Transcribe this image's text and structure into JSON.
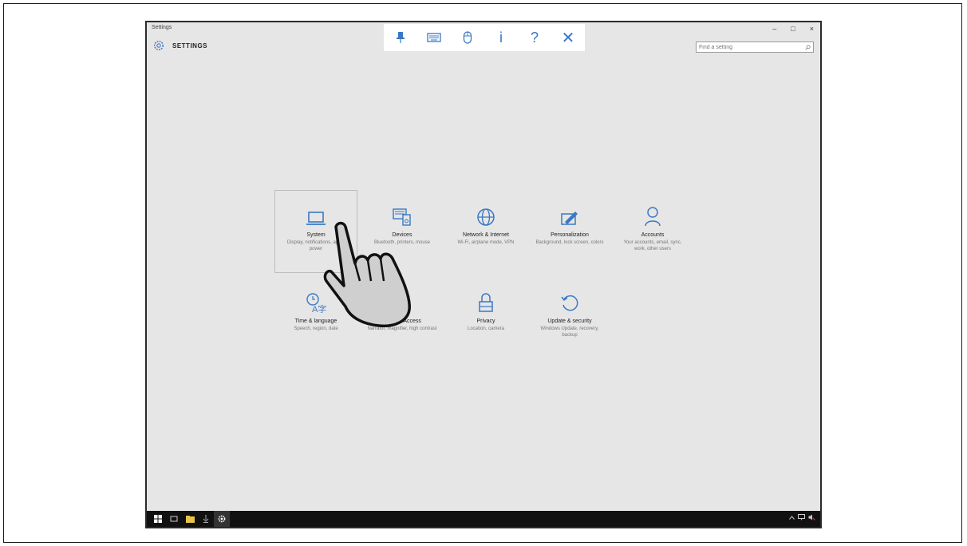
{
  "window": {
    "title": "Settings",
    "controls": {
      "minimize": "–",
      "maximize": "□",
      "close": "×"
    }
  },
  "header": {
    "title": "SETTINGS"
  },
  "search": {
    "placeholder": "Find a setting"
  },
  "toolbar": {
    "items": [
      "pin-icon",
      "keyboard-icon",
      "mouse-icon",
      "info-icon",
      "help-icon",
      "close-icon"
    ],
    "info_glyph": "i",
    "help_glyph": "?",
    "close_glyph": "✕"
  },
  "categories": [
    {
      "label": "System",
      "desc": "Display, notifications, apps, power",
      "icon": "laptop-icon"
    },
    {
      "label": "Devices",
      "desc": "Bluetooth, printers, mouse",
      "icon": "devices-icon"
    },
    {
      "label": "Network & Internet",
      "desc": "Wi-Fi, airplane mode, VPN",
      "icon": "globe-icon"
    },
    {
      "label": "Personalization",
      "desc": "Background, lock screen, colors",
      "icon": "personalization-icon"
    },
    {
      "label": "Accounts",
      "desc": "Your accounts, email, sync, work, other users",
      "icon": "person-icon"
    },
    {
      "label": "Time & language",
      "desc": "Speech, region, date",
      "icon": "time-language-icon"
    },
    {
      "label": "Ease of Access",
      "desc": "Narrator, magnifier, high contrast",
      "icon": "ease-of-access-icon"
    },
    {
      "label": "Privacy",
      "desc": "Location, camera",
      "icon": "lock-icon"
    },
    {
      "label": "Update & security",
      "desc": "Windows Update, recovery, backup",
      "icon": "update-icon"
    }
  ],
  "taskbar": {
    "items": [
      "start-icon",
      "task-view-icon",
      "file-explorer-icon",
      "store-icon",
      "settings-icon"
    ],
    "tray": [
      "chevron-up-icon",
      "network-icon",
      "volume-icon"
    ]
  },
  "colors": {
    "accent": "#3a78c4",
    "background": "#e6e6e6",
    "taskbar": "#111111"
  }
}
